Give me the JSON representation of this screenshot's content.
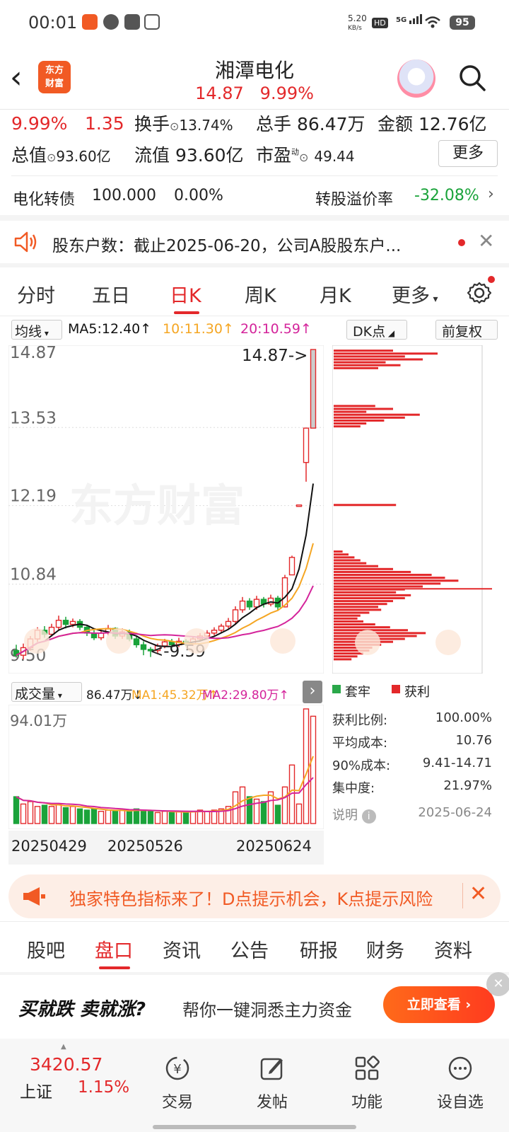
{
  "status_bar": {
    "time": "00:01",
    "net_speed": "5.20",
    "net_unit": "KB/s",
    "hd": "HD",
    "signal": "5G",
    "battery": "95"
  },
  "header": {
    "logo_line1": "东方",
    "logo_line2": "财富",
    "title": "湘潭电化",
    "price": "14.87",
    "change_pct": "9.99%"
  },
  "quote": {
    "pct": "9.99%",
    "change": "1.35",
    "turnover_label": "换手",
    "turnover": "13.74%",
    "volume_label": "总手",
    "volume": "86.47万",
    "amount_label": "金额",
    "amount": "12.76亿",
    "mktcap_label": "总值",
    "mktcap": "93.60亿",
    "float_label": "流值",
    "float_cap": "93.60亿",
    "pe_label": "市盈",
    "pe_sup": "动",
    "pe": "49.44",
    "more": "更多"
  },
  "bond": {
    "name": "电化转债",
    "price": "100.000",
    "pct": "0.00%",
    "premium_label": "转股溢价率",
    "premium": "-32.08%"
  },
  "notice": {
    "text": "股东户数：截止2025-06-20，公司A股股东户..."
  },
  "chart_tabs": [
    "分时",
    "五日",
    "日K",
    "周K",
    "月K",
    "更多"
  ],
  "indicator": {
    "ma_select": "均线",
    "ma5": "MA5:12.40↑",
    "ma10": "10:11.30↑",
    "ma20": "20:10.59↑",
    "dk": "DK点",
    "adjust": "前复权"
  },
  "chart_labels": {
    "y_top": "14.87",
    "y2": "13.53",
    "y3": "12.19",
    "y4": "10.84",
    "y_bottom": "9.50",
    "max_note": "14.87->",
    "min_note": "<-9.59",
    "watermark": "东方财富"
  },
  "volume_bar": {
    "select": "成交量",
    "vol": "86.47万↓",
    "ma1": "MA1:45.32万↑",
    "ma2": "MA2:29.80万↑",
    "vmax": "94.01万"
  },
  "dates": [
    "20250429",
    "20250526",
    "20250624"
  ],
  "legend": {
    "trapped": "套牢",
    "profit": "获利"
  },
  "stats": {
    "profit_ratio_label": "获利比例:",
    "profit_ratio": "100.00%",
    "avg_cost_label": "平均成本:",
    "avg_cost": "10.76",
    "cost90_label": "90%成本:",
    "cost90": "9.41-14.71",
    "concentration_label": "集中度:",
    "concentration": "21.97%",
    "note_label": "说明",
    "date": "2025-06-24"
  },
  "banner": {
    "text": "独家特色指标来了！D点提示机会，K点提示风险"
  },
  "bottom_tabs": [
    "股吧",
    "盘口",
    "资讯",
    "公告",
    "研报",
    "财务",
    "资料"
  ],
  "ad": {
    "slogan": "买就跌 卖就涨?",
    "text": "帮你一键洞悉主力资金",
    "button": "立即查看"
  },
  "index": {
    "value": "3420.57",
    "name": "上证",
    "pct": "1.15%"
  },
  "nav": [
    "交易",
    "发帖",
    "功能",
    "设自选"
  ],
  "colors": {
    "up": "#e3282a",
    "down": "#1aa33a",
    "accent": "#f15a24",
    "ma5": "#111111",
    "ma10": "#f5a623",
    "ma20": "#d4249b"
  },
  "chart_data": {
    "type": "candlestick",
    "note": "Daily K-line, 2025-04-29 to 2025-06-24",
    "ohlc": [
      [
        9.7,
        9.62,
        9.8,
        9.58
      ],
      [
        9.62,
        9.75,
        9.82,
        9.55
      ],
      [
        9.75,
        9.9,
        9.95,
        9.7
      ],
      [
        9.9,
        10.05,
        10.1,
        9.85
      ],
      [
        10.05,
        9.98,
        10.12,
        9.92
      ],
      [
        9.98,
        10.1,
        10.16,
        9.94
      ],
      [
        10.1,
        10.22,
        10.3,
        10.05
      ],
      [
        10.22,
        10.15,
        10.28,
        10.08
      ],
      [
        10.15,
        10.2,
        10.25,
        10.1
      ],
      [
        10.2,
        10.1,
        10.24,
        10.05
      ],
      [
        10.1,
        10.0,
        10.14,
        9.95
      ],
      [
        10.0,
        9.92,
        10.05,
        9.88
      ],
      [
        9.92,
        10.0,
        10.06,
        9.88
      ],
      [
        10.0,
        10.08,
        10.14,
        9.96
      ],
      [
        10.08,
        9.95,
        10.1,
        9.9
      ],
      [
        9.95,
        10.02,
        10.08,
        9.9
      ],
      [
        10.02,
        9.9,
        10.06,
        9.86
      ],
      [
        9.9,
        9.8,
        9.95,
        9.75
      ],
      [
        9.8,
        9.72,
        9.86,
        9.62
      ],
      [
        9.72,
        9.7,
        9.76,
        9.59
      ],
      [
        9.7,
        9.78,
        9.82,
        9.66
      ],
      [
        9.78,
        9.85,
        9.9,
        9.74
      ],
      [
        9.85,
        9.8,
        9.9,
        9.76
      ],
      [
        9.8,
        9.86,
        9.92,
        9.76
      ],
      [
        9.86,
        9.82,
        9.9,
        9.78
      ],
      [
        9.82,
        9.9,
        9.94,
        9.78
      ],
      [
        9.9,
        9.95,
        10.0,
        9.86
      ],
      [
        9.95,
        10.0,
        10.05,
        9.9
      ],
      [
        10.0,
        10.05,
        10.1,
        9.96
      ],
      [
        10.05,
        10.12,
        10.16,
        10.0
      ],
      [
        10.12,
        10.2,
        10.26,
        10.08
      ],
      [
        10.2,
        10.4,
        10.46,
        10.16
      ],
      [
        10.4,
        10.55,
        10.62,
        10.35
      ],
      [
        10.55,
        10.45,
        10.6,
        10.4
      ],
      [
        10.45,
        10.58,
        10.64,
        10.4
      ],
      [
        10.58,
        10.5,
        10.62,
        10.44
      ],
      [
        10.5,
        10.6,
        10.66,
        10.46
      ],
      [
        10.6,
        10.45,
        10.64,
        10.4
      ],
      [
        10.45,
        10.95,
        11.0,
        10.44
      ],
      [
        11.0,
        11.3,
        11.33,
        11.0
      ],
      [
        12.2,
        12.2,
        12.2,
        12.2
      ],
      [
        12.93,
        13.52,
        13.52,
        12.6
      ],
      [
        13.52,
        14.87,
        14.87,
        13.52
      ]
    ],
    "volume": [
      22,
      16,
      18,
      14,
      15,
      14,
      16,
      13,
      14,
      12,
      11,
      12,
      10,
      11,
      10,
      11,
      10,
      12,
      11,
      10,
      9,
      10,
      9,
      10,
      9,
      10,
      11,
      10,
      11,
      12,
      14,
      26,
      30,
      22,
      20,
      18,
      26,
      15,
      30,
      48,
      16,
      94,
      88
    ],
    "y_range": [
      9.5,
      14.87
    ],
    "dist_profit": [
      [
        14.85,
        40
      ],
      [
        14.8,
        70
      ],
      [
        14.75,
        48
      ],
      [
        14.7,
        60
      ],
      [
        14.65,
        35
      ],
      [
        14.6,
        45
      ],
      [
        14.55,
        30
      ],
      [
        13.9,
        28
      ],
      [
        13.85,
        40
      ],
      [
        13.8,
        22
      ],
      [
        13.75,
        58
      ],
      [
        13.7,
        48
      ],
      [
        13.65,
        34
      ],
      [
        13.6,
        22
      ],
      [
        13.55,
        18
      ],
      [
        12.2,
        42
      ],
      [
        11.4,
        6
      ],
      [
        11.35,
        10
      ],
      [
        11.3,
        14
      ],
      [
        11.25,
        18
      ],
      [
        11.2,
        22
      ],
      [
        11.15,
        30
      ],
      [
        11.1,
        40
      ],
      [
        11.05,
        52
      ],
      [
        11.0,
        66
      ],
      [
        10.95,
        75
      ],
      [
        10.9,
        84
      ],
      [
        10.85,
        72
      ],
      [
        10.8,
        60
      ],
      [
        10.75,
        48
      ],
      [
        10.7,
        42
      ],
      [
        10.65,
        52
      ],
      [
        10.6,
        48
      ],
      [
        10.55,
        40
      ],
      [
        10.5,
        36
      ],
      [
        10.45,
        30
      ],
      [
        10.4,
        32
      ],
      [
        10.35,
        24
      ],
      [
        10.3,
        18
      ],
      [
        10.25,
        16
      ],
      [
        10.2,
        20
      ],
      [
        10.15,
        28
      ],
      [
        10.1,
        38
      ],
      [
        10.05,
        50
      ],
      [
        10.0,
        62
      ],
      [
        9.95,
        56
      ],
      [
        9.9,
        48
      ],
      [
        9.85,
        40
      ],
      [
        9.8,
        32
      ],
      [
        9.75,
        26
      ],
      [
        9.7,
        24
      ],
      [
        9.65,
        20
      ],
      [
        9.6,
        16
      ],
      [
        9.55,
        12
      ]
    ]
  }
}
